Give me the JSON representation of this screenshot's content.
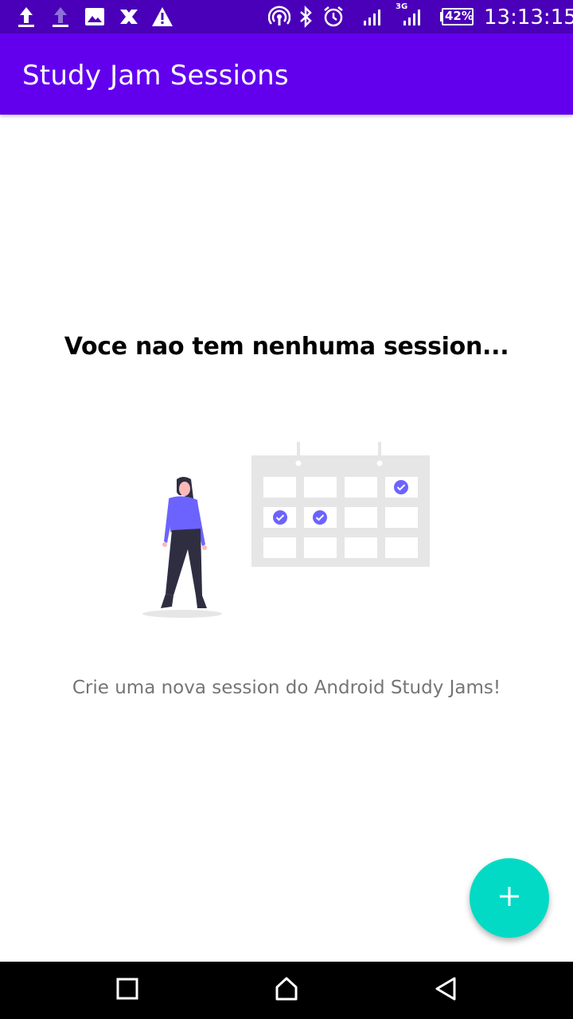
{
  "status_bar": {
    "time": "13:13:15",
    "battery": "42%",
    "network_label": "3G",
    "icons": [
      "upload-icon",
      "upload-icon",
      "image-icon",
      "x-app-icon",
      "warning-icon",
      "hotspot-icon",
      "bluetooth-icon",
      "alarm-icon",
      "signal-icon",
      "signal-3g-icon",
      "battery-icon"
    ]
  },
  "app_bar": {
    "title": "Study Jam Sessions",
    "color": "#6200ee"
  },
  "empty_state": {
    "title": "Voce nao tem nenhuma session...",
    "subtitle": "Crie uma nova session do Android Study Jams!",
    "illustration": "person-calendar-illustration",
    "accent_color": "#6c63ff"
  },
  "fab": {
    "icon": "plus-icon",
    "color": "#03dac5"
  },
  "nav_bar": {
    "icons": [
      "recent-apps-icon",
      "home-icon",
      "back-icon"
    ]
  }
}
